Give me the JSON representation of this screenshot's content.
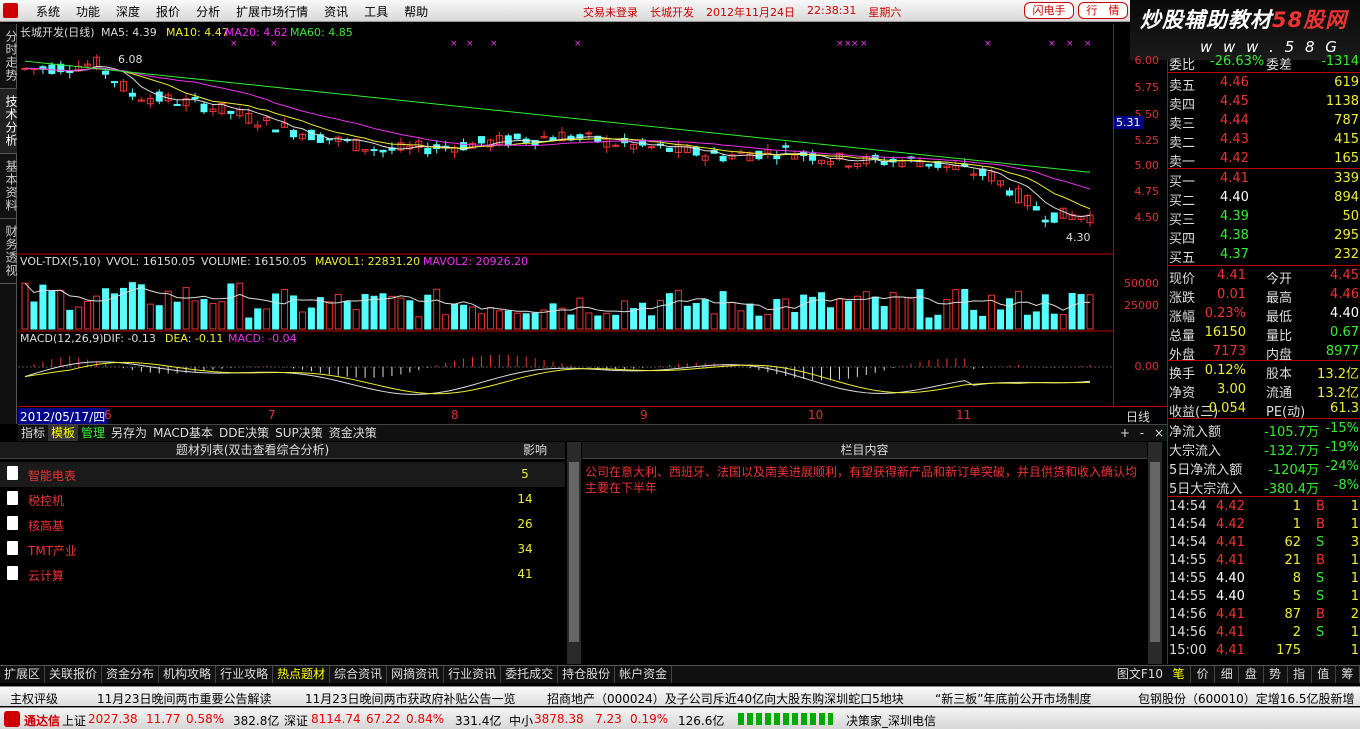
{
  "menu": [
    "系统",
    "功能",
    "深度",
    "报价",
    "分析",
    "扩展市场行情",
    "资讯",
    "工具",
    "帮助"
  ],
  "header": {
    "login_status": "交易未登录",
    "stock": "长城开发",
    "date": "2012年11月24日",
    "time": "22:38:31",
    "weekday": "星期六",
    "btn_flash": "闪电手",
    "btn_quote": "行　情"
  },
  "brand": {
    "title_a": "炒股辅助教材",
    "title_b": "58股网",
    "domain": "w w w . 5 8 G u . c o m"
  },
  "sidetabs": [
    "分时走势",
    "技术分析",
    "基本资料",
    "财务透视"
  ],
  "chart": {
    "title": "长城开发(日线)",
    "ma5": "MA5: 4.39",
    "ma10": "MA10: 4.47",
    "ma20": "MA20: 4.62",
    "ma60": "MA60: 4.85",
    "high_label": "6.08",
    "low_label": "4.30",
    "current_price_tag": "5.31",
    "price_ticks": [
      "6.00",
      "5.75",
      "5.50",
      "5.25",
      "5.00",
      "4.75",
      "4.50"
    ],
    "vol_title": "VOL-TDX(5,10)",
    "vvol": "VVOL: 16150.05",
    "volume": "VOLUME: 16150.05",
    "mavol1": "MAVOL1: 22831.20",
    "mavol2": "MAVOL2: 20926.20",
    "vol_ticks": [
      "50000",
      "25000"
    ],
    "macd_title": "MACD(12,26,9)",
    "dif": "DIF: -0.13",
    "dea": "DEA: -0.11",
    "macd": "MACD: -0.04",
    "macd_tick": "0.00",
    "date_start": "2012/05/17/四",
    "months": [
      "6",
      "7",
      "8",
      "9",
      "10",
      "11"
    ],
    "period": "日线"
  },
  "toolbar": {
    "tabs": [
      "指标",
      "模板",
      "管理",
      "另存为",
      "MACD基本",
      "DDE决策",
      "SUP决策",
      "资金决策"
    ],
    "right": [
      "+",
      "-"
    ]
  },
  "topics": {
    "head_name": "题材列表(双击查看综合分析)",
    "head_count": "影响",
    "head_content": "栏目内容",
    "items": [
      {
        "name": "智能电表",
        "count": "5"
      },
      {
        "name": "税控机",
        "count": "14"
      },
      {
        "name": "核高基",
        "count": "26"
      },
      {
        "name": "TMT产业",
        "count": "34"
      },
      {
        "name": "云计算",
        "count": "41"
      }
    ],
    "content": "公司在意大利、西班牙、法国以及南美进展顺利，有望获得新产品和新订单突破，并且供货和收入确认均主要在下半年"
  },
  "bottom_tabs": [
    "扩展区",
    "关联报价",
    "资金分布",
    "机构攻略",
    "行业攻略",
    "热点题材",
    "综合资讯",
    "网摘资讯",
    "行业资讯",
    "委托成交",
    "持仓股份",
    "帐户资金"
  ],
  "bottom_right": "图文F10",
  "quote": {
    "weibi": "委比",
    "weibi_val": "-26.63%",
    "weicha": "委差",
    "weicha_val": "-1314",
    "asks": [
      {
        "l": "卖五",
        "p": "4.46",
        "v": "619"
      },
      {
        "l": "卖四",
        "p": "4.45",
        "v": "1138"
      },
      {
        "l": "卖三",
        "p": "4.44",
        "v": "787"
      },
      {
        "l": "卖二",
        "p": "4.43",
        "v": "415"
      },
      {
        "l": "卖一",
        "p": "4.42",
        "v": "165"
      }
    ],
    "bids": [
      {
        "l": "买一",
        "p": "4.41",
        "v": "339"
      },
      {
        "l": "买二",
        "p": "4.40",
        "v": "894"
      },
      {
        "l": "买三",
        "p": "4.39",
        "v": "50"
      },
      {
        "l": "买四",
        "p": "4.38",
        "v": "295"
      },
      {
        "l": "买五",
        "p": "4.37",
        "v": "232"
      }
    ],
    "stats": [
      {
        "a": "现价",
        "b": "4.41",
        "c": "今开",
        "d": "4.45"
      },
      {
        "a": "涨跌",
        "b": "0.01",
        "c": "最高",
        "d": "4.46"
      },
      {
        "a": "涨幅",
        "b": "0.23%",
        "c": "最低",
        "d": "4.40"
      },
      {
        "a": "总量",
        "b": "16150",
        "c": "量比",
        "d": "0.67"
      },
      {
        "a": "外盘",
        "b": "7173",
        "c": "内盘",
        "d": "8977"
      }
    ],
    "stats2": [
      {
        "a": "换手",
        "b": "0.12%",
        "c": "股本",
        "d": "13.2亿"
      },
      {
        "a": "净资",
        "b": "3.00",
        "c": "流通",
        "d": "13.2亿"
      },
      {
        "a": "收益(三)",
        "b": "0.054",
        "c": "PE(动)",
        "d": "61.3"
      }
    ],
    "flows": [
      {
        "a": "净流入额",
        "b": "-105.7万",
        "c": "-15%"
      },
      {
        "a": "大宗流入",
        "b": "-132.7万",
        "c": "-19%"
      },
      {
        "a": "5日净流入额",
        "b": "-1204万",
        "c": "-24%"
      },
      {
        "a": "5日大宗流入",
        "b": "-380.4万",
        "c": "-8%"
      }
    ],
    "ticks": [
      {
        "t": "14:54",
        "p": "4.42",
        "v": "1",
        "s": "B",
        "n": "1"
      },
      {
        "t": "14:54",
        "p": "4.42",
        "v": "1",
        "s": "B",
        "n": "1"
      },
      {
        "t": "14:54",
        "p": "4.41",
        "v": "62",
        "s": "S",
        "n": "3"
      },
      {
        "t": "14:55",
        "p": "4.41",
        "v": "21",
        "s": "B",
        "n": "1"
      },
      {
        "t": "14:55",
        "p": "4.40",
        "v": "8",
        "s": "S",
        "n": "1"
      },
      {
        "t": "14:55",
        "p": "4.40",
        "v": "5",
        "s": "S",
        "n": "1"
      },
      {
        "t": "14:56",
        "p": "4.41",
        "v": "87",
        "s": "B",
        "n": "2"
      },
      {
        "t": "14:56",
        "p": "4.41",
        "v": "2",
        "s": "S",
        "n": "1"
      },
      {
        "t": "15:00",
        "p": "4.41",
        "v": "175",
        "s": "",
        "n": "1"
      }
    ],
    "tabs": [
      "笔",
      "价",
      "细",
      "盘",
      "势",
      "指",
      "值",
      "筹"
    ]
  },
  "news": [
    "主权评级",
    "11月23日晚间两市重要公告解读",
    "11月23日晚间两市获政府补贴公告一览",
    "招商地产（000024）及子公司斥近40亿向大股东购深圳蛇口5地块",
    "“新三板”年底前公开市场制度",
    "包钢股份（600010）定增16.5亿股新增"
  ],
  "status": {
    "app": "通达信",
    "sh": "上证",
    "sh_v": "2027.38",
    "sh_c": "11.77",
    "sh_p": "0.58%",
    "sh_a": "382.8亿",
    "sz": "深证",
    "sz_v": "8114.74",
    "sz_c": "67.22",
    "sz_p": "0.84%",
    "sz_a": "331.4亿",
    "zx": "中小",
    "zx_v": "3878.38",
    "zx_c": "7.23",
    "zx_p": "0.19%",
    "zx_a": "126.6亿",
    "conn": "决策家_深圳电信"
  }
}
